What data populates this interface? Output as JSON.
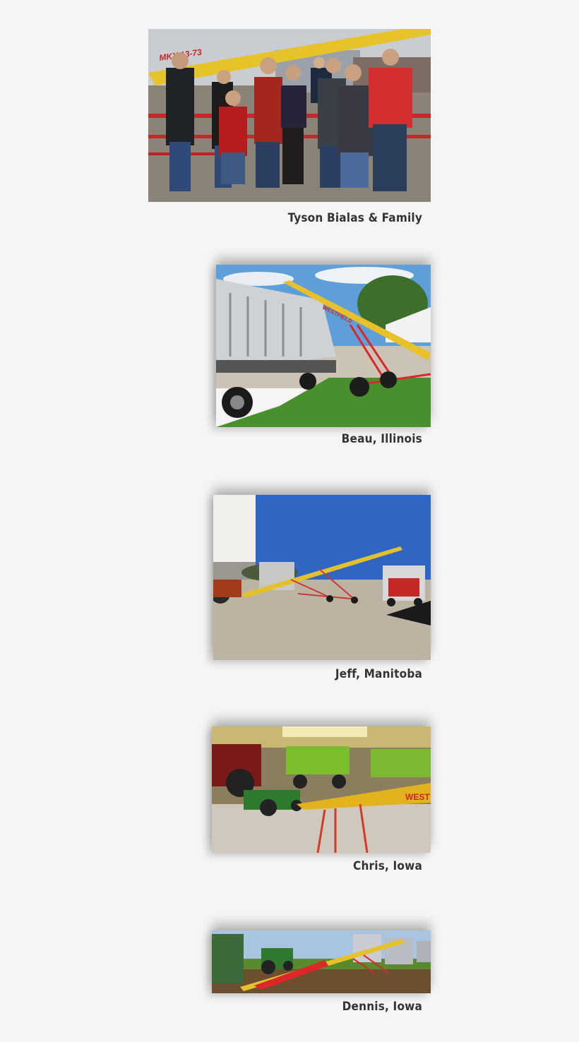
{
  "testimonials": [
    {
      "caption": "Tyson Bialas & Family",
      "photo_text": "MKX 13-73"
    },
    {
      "caption": "Beau, Illinois",
      "photo_text": "WESTFIELD"
    },
    {
      "caption": "Jeff, Manitoba"
    },
    {
      "caption": "Chris, Iowa",
      "photo_text": "WEST"
    },
    {
      "caption": "Dennis, Iowa"
    }
  ],
  "colors": {
    "background": "#f5f5f5",
    "caption_text": "#333333",
    "auger_yellow": "#e8c02a",
    "auger_red": "#d9272a"
  }
}
